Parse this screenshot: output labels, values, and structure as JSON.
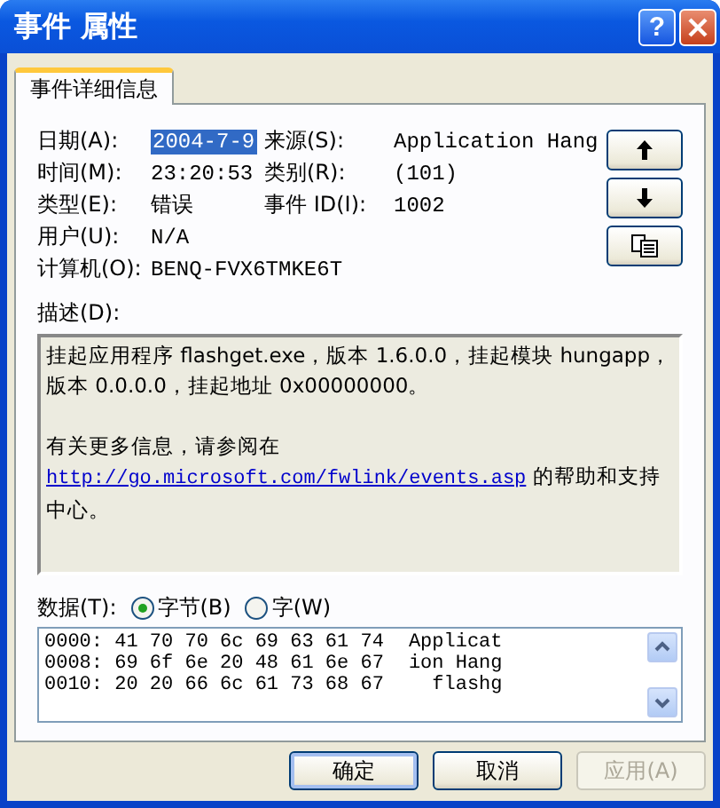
{
  "window": {
    "title": "事件 属性",
    "help_button": "?"
  },
  "tabs": [
    {
      "label": "事件详细信息",
      "selected": true
    }
  ],
  "fields": [
    [
      {
        "label": "日期(A):",
        "value": "2004-7-9",
        "selected": true
      },
      {
        "label": "来源(S):",
        "value": "Application Hang",
        "selected": false
      }
    ],
    [
      {
        "label": "时间(M):",
        "value": "23:20:53",
        "selected": false
      },
      {
        "label": "类别(R):",
        "value": "(101)",
        "selected": false
      }
    ],
    [
      {
        "label": "类型(E):",
        "value": "错误",
        "selected": false
      },
      {
        "label": "事件 ID(I):",
        "value": "1002",
        "selected": false
      }
    ],
    [
      {
        "label": "用户(U):",
        "value": "N/A",
        "selected": false
      }
    ],
    [
      {
        "label": "计算机(O):",
        "value": "BENQ-FVX6TMKE6T",
        "selected": false
      }
    ]
  ],
  "description": {
    "label": "描述(D):",
    "paragraphs": [
      {
        "text": "挂起应用程序 flashget.exe，版本 1.6.0.0，挂起模块 hungapp，版本 0.0.0.0，挂起地址 0x00000000。"
      },
      {
        "text": "有关更多信息，请参阅在",
        "link": "http://go.microsoft.com/fwlink/events.asp",
        "after": " 的帮助和支持中心。"
      }
    ]
  },
  "data": {
    "label": "数据(T):",
    "options": [
      {
        "label": "字节(B)",
        "selected": true
      },
      {
        "label": "字(W)",
        "selected": false
      }
    ],
    "rows": [
      {
        "offset": "0000:",
        "bytes": "41 70 70 6c 69 63 61 74",
        "text": "Applicat"
      },
      {
        "offset": "0008:",
        "bytes": "69 6f 6e 20 48 61 6e 67",
        "text": "ion Hang"
      },
      {
        "offset": "0010:",
        "bytes": "20 20 66 6c 61 73 68 67",
        "text": "  flashg"
      }
    ]
  },
  "buttons": [
    {
      "label": "确定",
      "default": true,
      "disabled": false
    },
    {
      "label": "取消",
      "default": false,
      "disabled": false
    },
    {
      "label": "应用(A)",
      "default": false,
      "disabled": true
    }
  ]
}
